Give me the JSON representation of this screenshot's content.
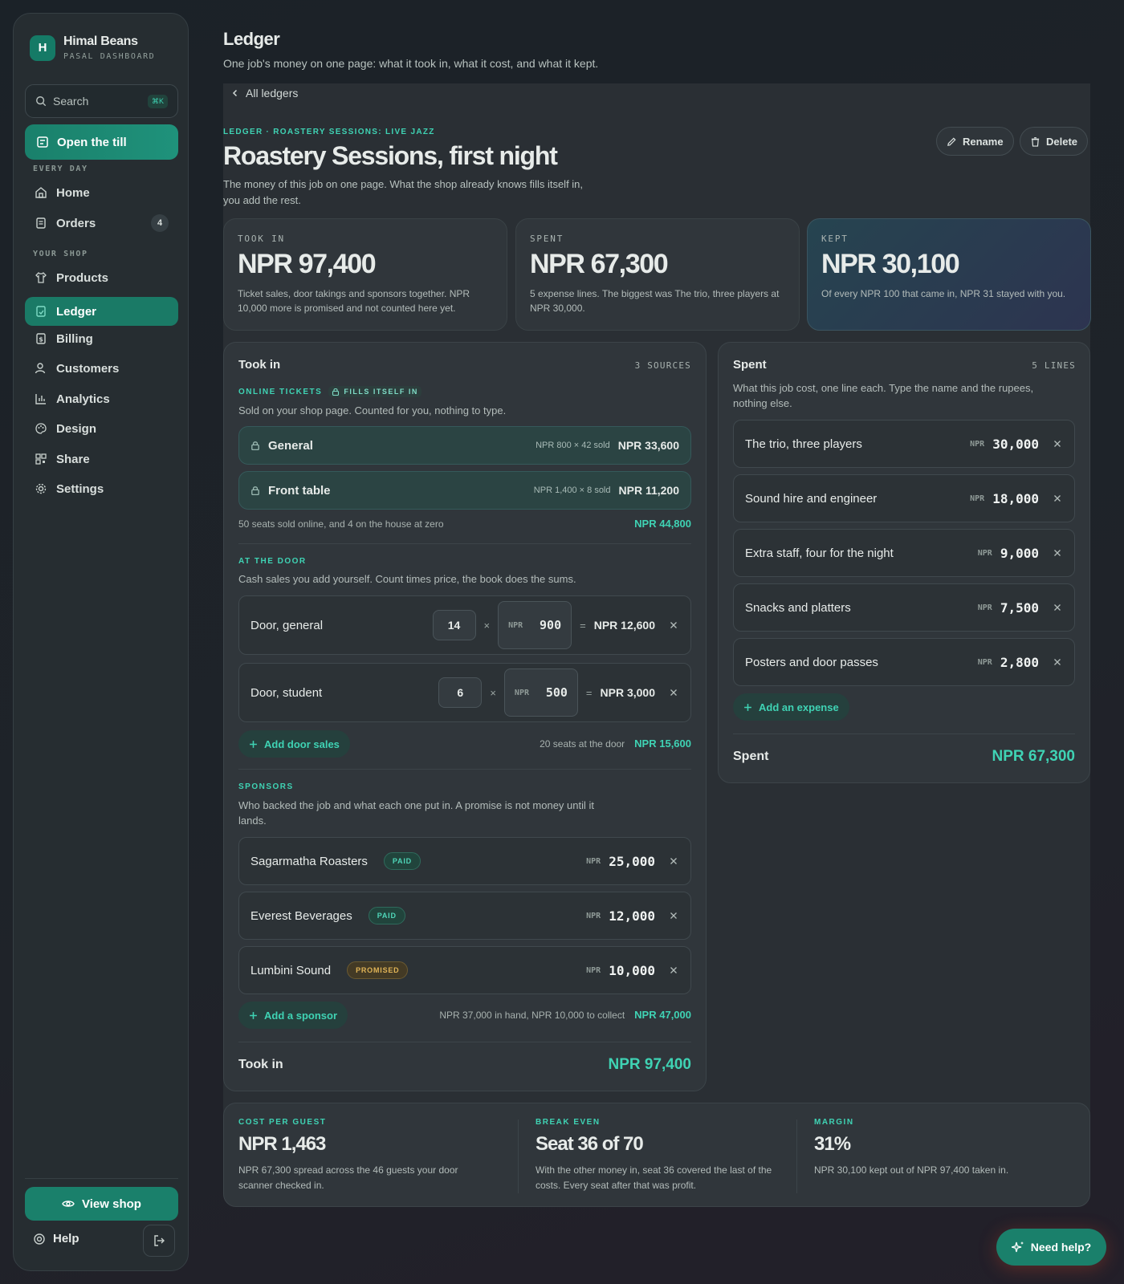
{
  "brand": {
    "name": "Himal Beans",
    "sub": "PASAL DASHBOARD",
    "logo": "H"
  },
  "search": {
    "placeholder": "Search",
    "shortcut": "⌘K"
  },
  "sidebar": {
    "till": "Open the till",
    "section_every_day": "EVERY DAY",
    "section_your_shop": "YOUR SHOP",
    "items": [
      {
        "label": "Home",
        "icon": "home-icon"
      },
      {
        "label": "Orders",
        "icon": "orders-icon",
        "badge": "4"
      },
      {
        "label": "Products",
        "icon": "shirt-icon"
      },
      {
        "label": "Ledger",
        "icon": "ledger-icon",
        "active": true
      },
      {
        "label": "Billing",
        "icon": "billing-icon"
      },
      {
        "label": "Customers",
        "icon": "users-icon"
      },
      {
        "label": "Analytics",
        "icon": "chart-icon"
      },
      {
        "label": "Design",
        "icon": "palette-icon"
      },
      {
        "label": "Share",
        "icon": "qr-icon"
      },
      {
        "label": "Settings",
        "icon": "gear-icon"
      }
    ],
    "view_shop": "View shop",
    "help": "Help"
  },
  "page": {
    "title": "Ledger",
    "subtitle": "One job's money on one page: what it took in, what it cost, and what it kept.",
    "back": "All ledgers"
  },
  "ledger": {
    "eyebrow": "LEDGER · ROASTERY SESSIONS: LIVE JAZZ",
    "title": "Roastery Sessions, first night",
    "desc": "The money of this job on one page. What the shop already knows fills itself in, you add the rest.",
    "rename": "Rename",
    "delete": "Delete"
  },
  "stats": {
    "took_in": {
      "label": "TOOK IN",
      "value": "NPR 97,400",
      "desc": "Ticket sales, door takings and sponsors together. NPR 10,000 more is promised and not counted here yet."
    },
    "spent": {
      "label": "SPENT",
      "value": "NPR 67,300",
      "desc": "5 expense lines. The biggest was The trio, three players at NPR 30,000."
    },
    "kept": {
      "label": "KEPT",
      "value": "NPR 30,100",
      "desc": "Of every NPR 100 that came in, NPR 31 stayed with you."
    }
  },
  "took_in": {
    "title": "Took in",
    "count": "3 SOURCES",
    "online": {
      "label": "ONLINE TICKETS",
      "auto_tag": "FILLS ITSELF IN",
      "desc": "Sold on your shop page. Counted for you, nothing to type.",
      "rows": [
        {
          "name": "General",
          "calc": "NPR 800 × 42 sold",
          "amount": "NPR 33,600"
        },
        {
          "name": "Front table",
          "calc": "NPR 1,400 × 8 sold",
          "amount": "NPR 11,200"
        }
      ],
      "summary": "50 seats sold online, and 4 on the house at zero",
      "total": "NPR 44,800"
    },
    "door": {
      "label": "AT THE DOOR",
      "desc": "Cash sales you add yourself. Count times price, the book does the sums.",
      "rows": [
        {
          "name": "Door, general",
          "qty": "14",
          "currency": "NPR",
          "price": "900",
          "total": "NPR 12,600"
        },
        {
          "name": "Door, student",
          "qty": "6",
          "currency": "NPR",
          "price": "500",
          "total": "NPR 3,000"
        }
      ],
      "add": "Add door sales",
      "summary": "20 seats at the door",
      "total": "NPR 15,600"
    },
    "sponsors": {
      "label": "SPONSORS",
      "desc": "Who backed the job and what each one put in. A promise is not money until it lands.",
      "rows": [
        {
          "name": "Sagarmatha Roasters",
          "status": "PAID",
          "currency": "NPR",
          "amount": "25,000"
        },
        {
          "name": "Everest Beverages",
          "status": "PAID",
          "currency": "NPR",
          "amount": "12,000"
        },
        {
          "name": "Lumbini Sound",
          "status": "PROMISED",
          "currency": "NPR",
          "amount": "10,000"
        }
      ],
      "add": "Add a sponsor",
      "summary": "NPR 37,000 in hand, NPR 10,000 to collect",
      "total": "NPR 47,000"
    },
    "total_label": "Took in",
    "total": "NPR 97,400"
  },
  "spent": {
    "title": "Spent",
    "count": "5 LINES",
    "desc": "What this job cost, one line each. Type the name and the rupees, nothing else.",
    "rows": [
      {
        "name": "The trio, three players",
        "currency": "NPR",
        "amount": "30,000"
      },
      {
        "name": "Sound hire and engineer",
        "currency": "NPR",
        "amount": "18,000"
      },
      {
        "name": "Extra staff, four for the night",
        "currency": "NPR",
        "amount": "9,000"
      },
      {
        "name": "Snacks and platters",
        "currency": "NPR",
        "amount": "7,500"
      },
      {
        "name": "Posters and door passes",
        "currency": "NPR",
        "amount": "2,800"
      }
    ],
    "add": "Add an expense",
    "total_label": "Spent",
    "total": "NPR 67,300"
  },
  "metrics": [
    {
      "label": "COST PER GUEST",
      "value": "NPR 1,463",
      "desc": "NPR 67,300 spread across the 46 guests your door scanner checked in."
    },
    {
      "label": "BREAK EVEN",
      "value": "Seat 36 of 70",
      "desc": "With the other money in, seat 36 covered the last of the costs. Every seat after that was profit."
    },
    {
      "label": "MARGIN",
      "value": "31%",
      "desc": "NPR 30,100 kept out of NPR 97,400 taken in."
    }
  ],
  "need_help": "Need help?",
  "colors": {
    "accent": "#3fd3b4",
    "button": "#1a806b",
    "promised": "#e0b457"
  }
}
